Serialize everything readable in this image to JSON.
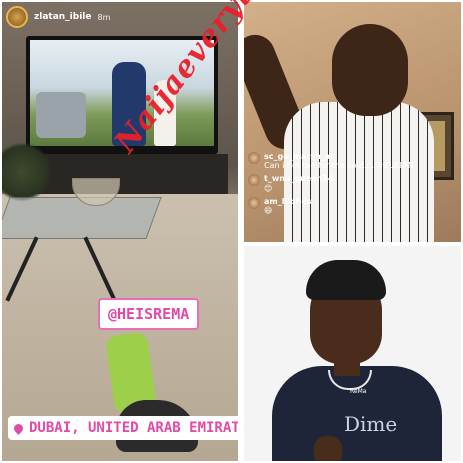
{
  "story": {
    "username": "zlatan_ibile",
    "time": "8m",
    "mention": "@HEISREMA",
    "location": "DUBAI, UNITED ARAB EMIRATE"
  },
  "live_comments": [
    {
      "user": "sc_go_marsh_al",
      "text": "Can i hot tea for the cold.... #ZLATAN"
    },
    {
      "user": "t_wna_queen34",
      "text": "😊"
    },
    {
      "user": "am_lilbhes",
      "text": "😄"
    }
  ],
  "shirt_text": {
    "small": "ReMa",
    "logo": "Dime"
  },
  "watermark": "Naijaeverything",
  "colors": {
    "story_pill_text": "#e24aa8",
    "watermark": "#e8202a"
  }
}
